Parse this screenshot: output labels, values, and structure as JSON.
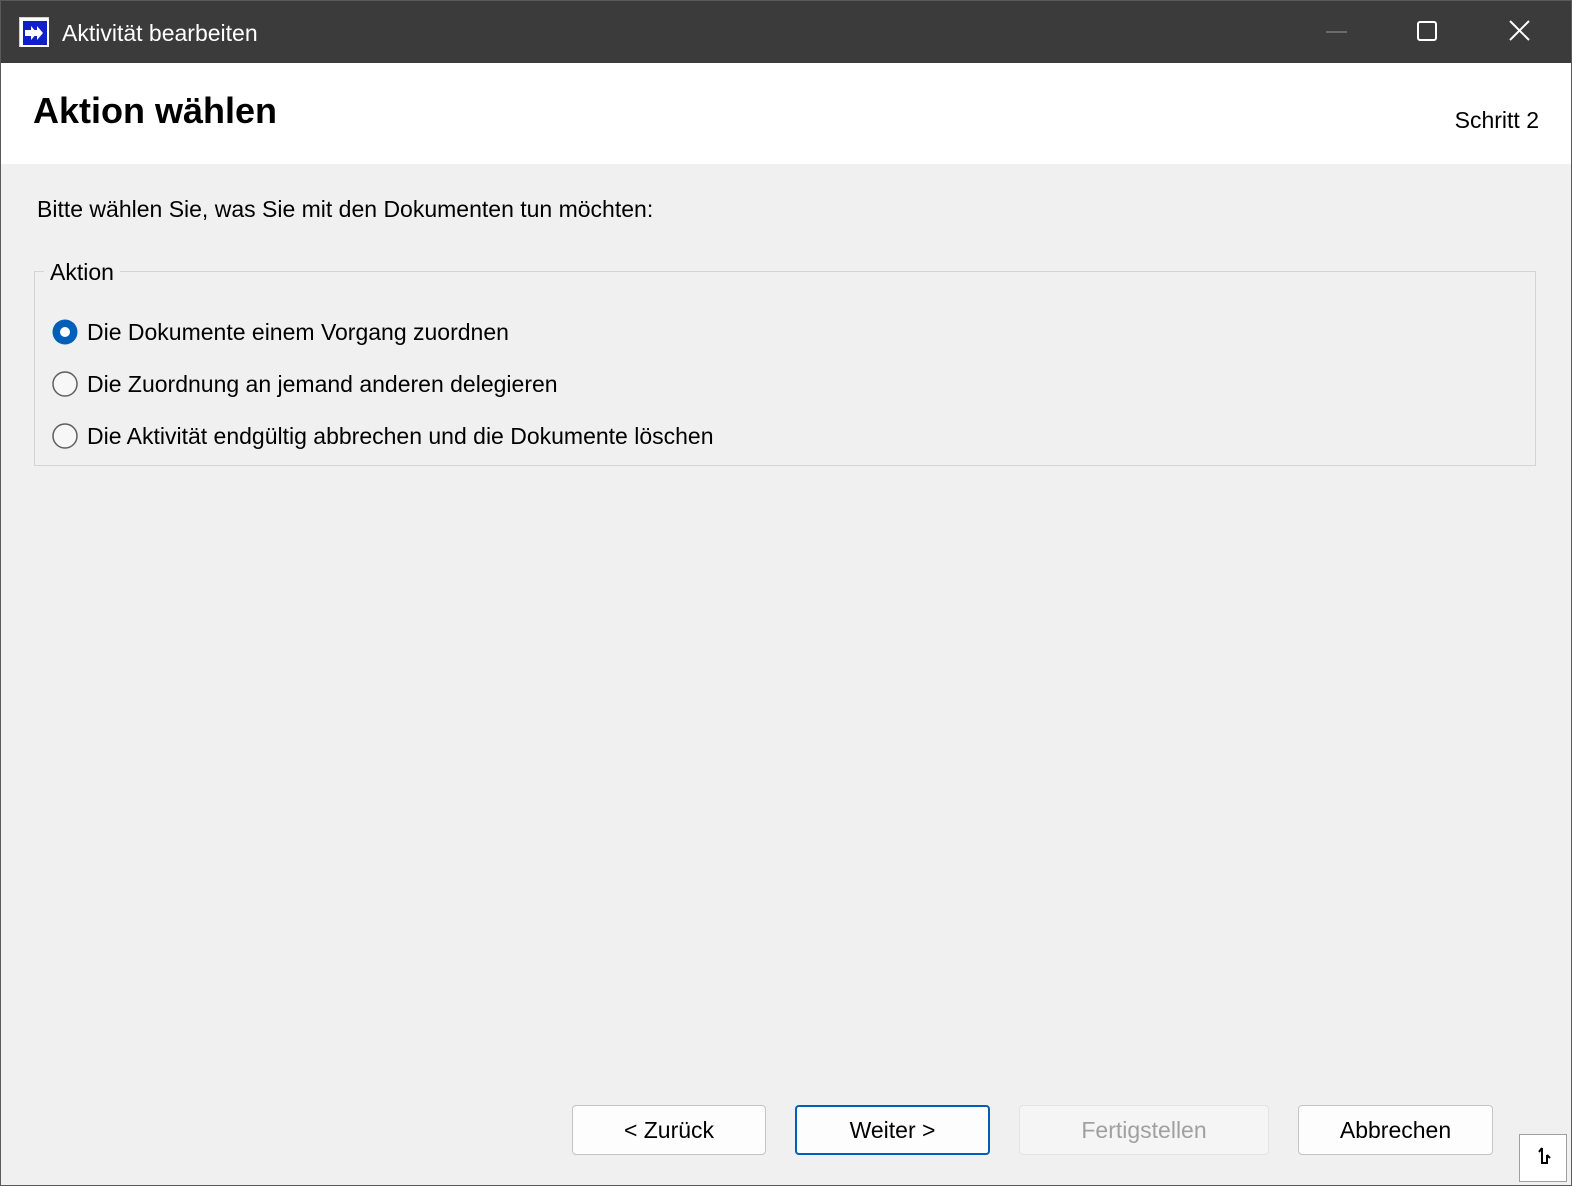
{
  "window": {
    "title": "Aktivität bearbeiten",
    "controls": {
      "minimize": "minimize-icon",
      "maximize": "maximize-icon",
      "close": "close-icon"
    },
    "accent_color": "#005fb8",
    "titlebar_color": "#3b3b3b"
  },
  "header": {
    "title": "Aktion wählen",
    "step": "Schritt 2"
  },
  "content": {
    "prompt": "Bitte wählen Sie, was Sie mit den Dokumenten tun möchten:",
    "group": {
      "legend": "Aktion",
      "options": [
        {
          "label": "Die Dokumente einem Vorgang zuordnen",
          "selected": true
        },
        {
          "label": "Die Zuordnung an jemand anderen delegieren",
          "selected": false
        },
        {
          "label": "Die Aktivität endgültig abbrechen und die Dokumente löschen",
          "selected": false
        }
      ]
    }
  },
  "footer": {
    "back_label": "< Zurück",
    "next_label": "Weiter >",
    "finish_label": "Fertigstellen",
    "cancel_label": "Abbrechen",
    "finish_enabled": false
  }
}
